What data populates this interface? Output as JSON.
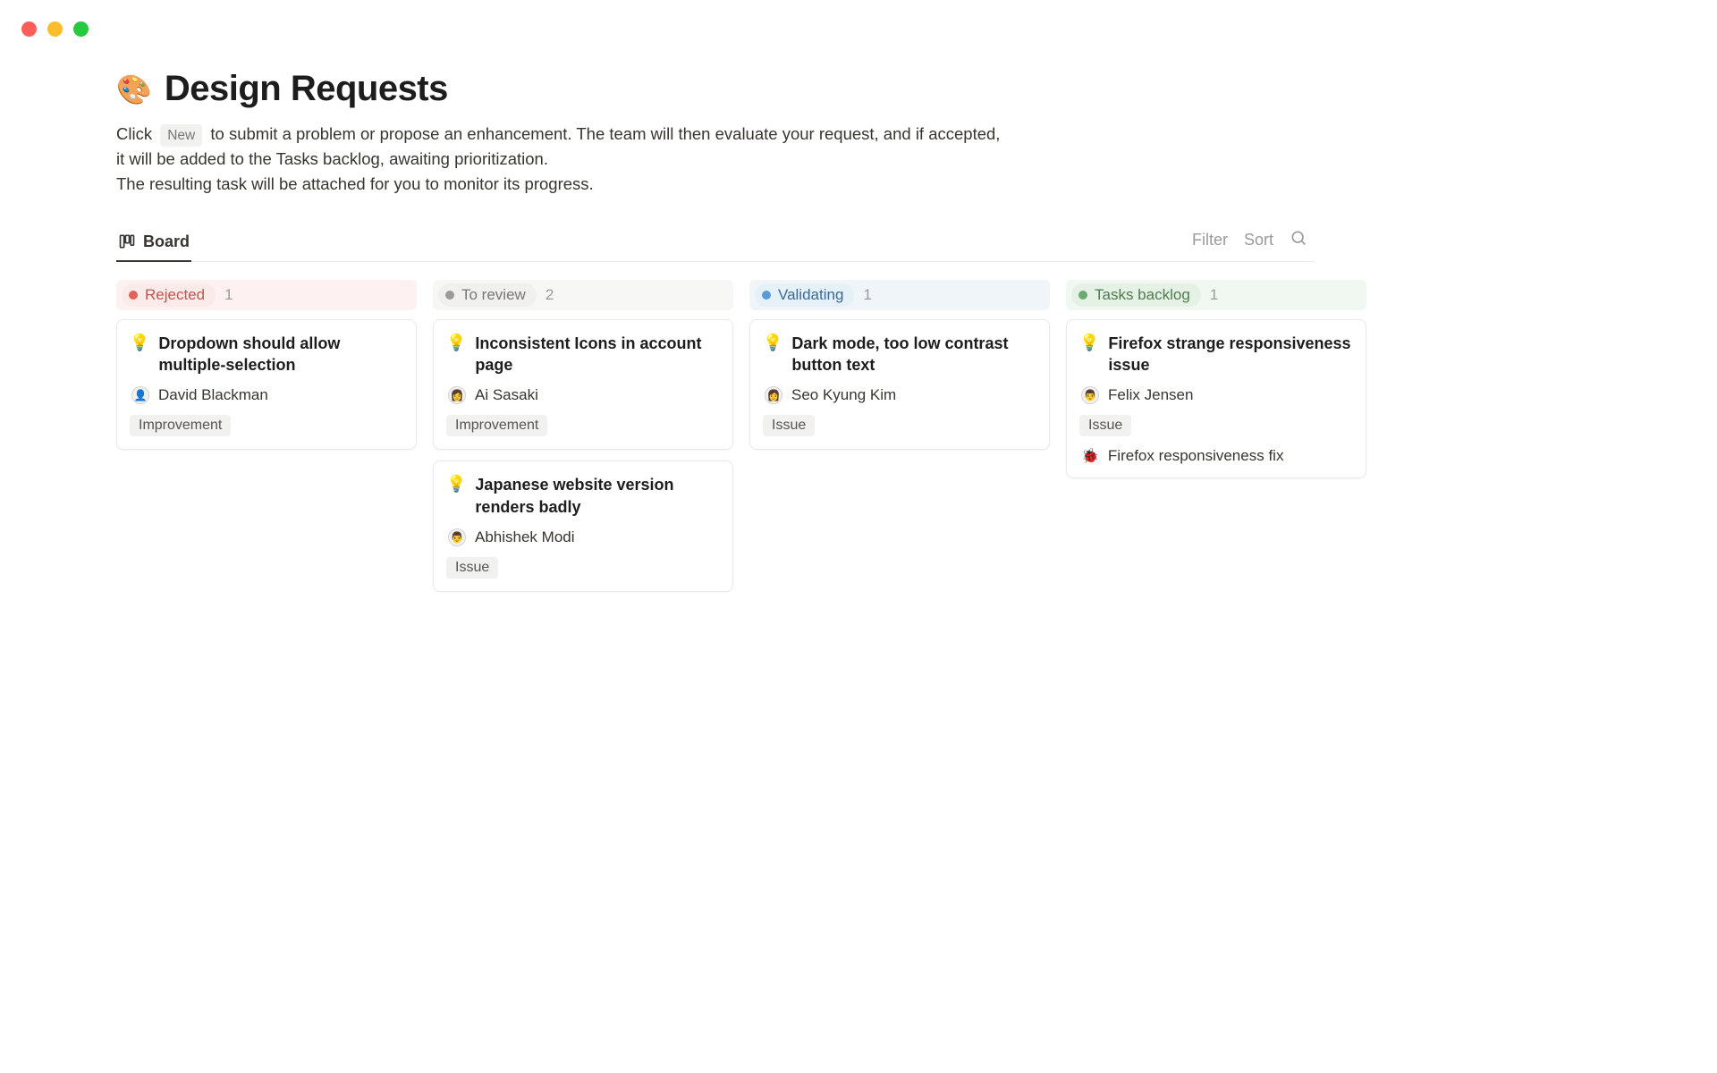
{
  "window": {
    "controls": [
      "red",
      "yellow",
      "green"
    ]
  },
  "page": {
    "icon": "🎨",
    "title": "Design Requests",
    "description_before": "Click",
    "new_label": "New",
    "description_after": "to submit a problem or propose an enhancement. The team will then evaluate your request, and if accepted, it will be added to the Tasks backlog, awaiting prioritization.",
    "description_line2": "The resulting task will be attached for you to monitor its progress."
  },
  "view": {
    "tab_label": "Board",
    "filter_label": "Filter",
    "sort_label": "Sort"
  },
  "columns": [
    {
      "id": "rejected",
      "label": "Rejected",
      "count": "1",
      "bg": "bg-red",
      "pill": "pill-red",
      "dot": "dot-status-red",
      "cards": [
        {
          "icon": "💡",
          "title": "Dropdown should allow multiple-selection",
          "assignee": "David Blackman",
          "avatar": "👤",
          "tag": "Improvement"
        }
      ]
    },
    {
      "id": "to-review",
      "label": "To review",
      "count": "2",
      "bg": "bg-gray",
      "pill": "pill-gray",
      "dot": "dot-status-gray",
      "cards": [
        {
          "icon": "💡",
          "title": "Inconsistent Icons in account page",
          "assignee": "Ai Sasaki",
          "avatar": "👩",
          "tag": "Improvement"
        },
        {
          "icon": "💡",
          "title": "Japanese website version renders badly",
          "assignee": "Abhishek Modi",
          "avatar": "👨",
          "tag": "Issue"
        }
      ]
    },
    {
      "id": "validating",
      "label": "Validating",
      "count": "1",
      "bg": "bg-blue",
      "pill": "pill-blue",
      "dot": "dot-status-blue",
      "cards": [
        {
          "icon": "💡",
          "title": "Dark mode, too low contrast button text",
          "assignee": "Seo Kyung Kim",
          "avatar": "👩",
          "tag": "Issue"
        }
      ]
    },
    {
      "id": "tasks-backlog",
      "label": "Tasks backlog",
      "count": "1",
      "bg": "bg-green",
      "pill": "pill-green",
      "dot": "dot-status-green",
      "cards": [
        {
          "icon": "💡",
          "title": "Firefox strange responsiveness issue",
          "assignee": "Felix Jensen",
          "avatar": "👨",
          "tag": "Issue",
          "linked_icon": "🐞",
          "linked_text": "Firefox responsiveness fix"
        }
      ]
    }
  ]
}
